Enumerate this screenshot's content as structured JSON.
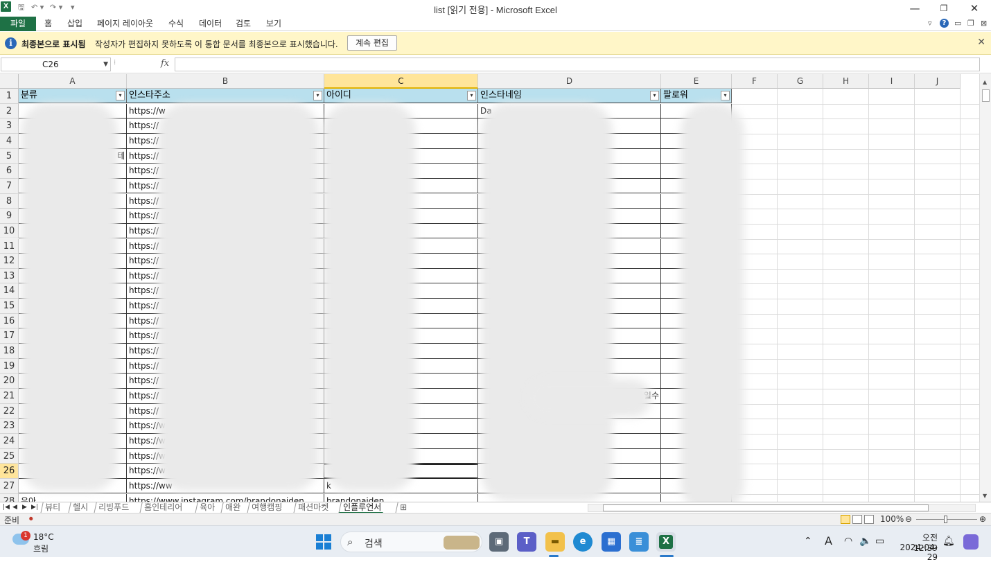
{
  "window": {
    "title": "list  [읽기 전용] - Microsoft Excel",
    "app_icon_letter": "X",
    "quick_access": [
      "save-icon",
      "undo-icon",
      "redo-icon",
      "customize-icon"
    ],
    "controls": {
      "minimize": "—",
      "restore": "❐",
      "close": "✕"
    }
  },
  "ribbon": {
    "file_tab": "파일",
    "tabs": [
      "홈",
      "삽입",
      "페이지 레이아웃",
      "수식",
      "데이터",
      "검토",
      "보기"
    ]
  },
  "message_bar": {
    "title": "최종본으로 표시됨",
    "text": "작성자가 편집하지 못하도록 이 통합 문서를 최종본으로 표시했습니다.",
    "button": "계속 편집"
  },
  "formula_bar": {
    "name_box": "C26",
    "fx": "fx",
    "formula": ""
  },
  "columns": [
    "A",
    "B",
    "C",
    "D",
    "E",
    "F",
    "G",
    "H",
    "I",
    "J"
  ],
  "selected_column": "C",
  "header_row": [
    "분류",
    "인스타주소",
    "아이디",
    "인스타네임",
    "팔로워"
  ],
  "rows": [
    {
      "n": "1"
    },
    {
      "n": "2",
      "b": "https://w",
      "d": "Da"
    },
    {
      "n": "3",
      "b": "https://"
    },
    {
      "n": "4",
      "b": "https://"
    },
    {
      "n": "5",
      "a_tail": "테",
      "b": "https://"
    },
    {
      "n": "6",
      "b": "https://"
    },
    {
      "n": "7",
      "b": "https://"
    },
    {
      "n": "8",
      "b": "https://"
    },
    {
      "n": "9",
      "b": "https://"
    },
    {
      "n": "10",
      "b": "https://"
    },
    {
      "n": "11",
      "b": "https://"
    },
    {
      "n": "12",
      "b": "https://"
    },
    {
      "n": "13",
      "b": "https://"
    },
    {
      "n": "14",
      "b": "https://"
    },
    {
      "n": "15",
      "b": "https://"
    },
    {
      "n": "16",
      "b": "https://"
    },
    {
      "n": "17",
      "b": "https://"
    },
    {
      "n": "18",
      "b": "https://"
    },
    {
      "n": "19",
      "b": "https://"
    },
    {
      "n": "20",
      "b": "https://"
    },
    {
      "n": "21",
      "b": "https://",
      "d_tail": "일수"
    },
    {
      "n": "22",
      "b": "https://"
    },
    {
      "n": "23",
      "b": "https://w"
    },
    {
      "n": "24",
      "b": "https://w"
    },
    {
      "n": "25",
      "b": "https://w"
    },
    {
      "n": "26",
      "b": "https://w"
    },
    {
      "n": "27",
      "b": "https://ww",
      "c": "k"
    },
    {
      "n": "28",
      "a": "유아",
      "b": "https://www.instagram.com/brandonaiden",
      "c": "brandonaiden"
    }
  ],
  "sheet_tabs": [
    "뷰티",
    "헬시",
    "리빙푸드",
    "홈인테리어",
    "육아",
    "애완",
    "여행캠핑",
    "패션마켓",
    "인플루언서"
  ],
  "active_sheet": "인플루언서",
  "status": {
    "ready": "준비",
    "zoom": "100%"
  },
  "taskbar": {
    "weather_badge": "1",
    "temperature": "18°C",
    "condition": "흐림",
    "search_label": "검색",
    "time": "오전 12:39",
    "date": "2024-04-29",
    "ime": "A"
  },
  "colors": {
    "excel_green": "#1e7145",
    "header_fill": "#b9e0ee",
    "message_bar": "#fff6c8",
    "selection": "#ffe59a"
  }
}
